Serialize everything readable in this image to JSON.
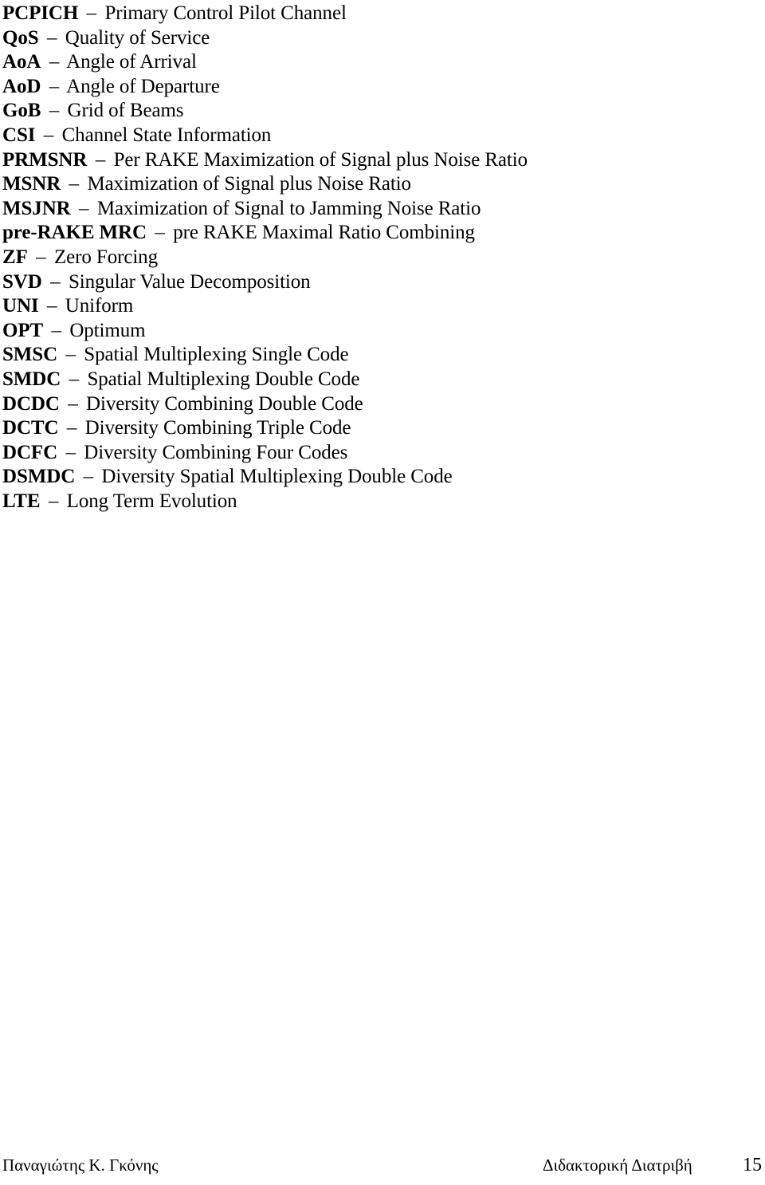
{
  "document": {
    "page_number": "15",
    "separator": "–"
  },
  "abbreviations": [
    {
      "term": "PCPICH",
      "definition": "Primary Control Pilot Channel"
    },
    {
      "term": "QoS",
      "definition": "Quality of Service"
    },
    {
      "term": "AoA",
      "definition": "Angle of Arrival"
    },
    {
      "term": "AoD",
      "definition": "Angle of Departure"
    },
    {
      "term": "GoB",
      "definition": "Grid of Beams"
    },
    {
      "term": "CSI",
      "definition": "Channel State Information"
    },
    {
      "term": "PRMSNR",
      "definition": "Per RAKE Maximization of Signal plus Noise Ratio"
    },
    {
      "term": "MSNR",
      "definition": "Maximization of Signal plus Noise Ratio"
    },
    {
      "term": "MSJNR",
      "definition": "Maximization of Signal to Jamming Noise Ratio"
    },
    {
      "term": "pre-RAKE MRC",
      "definition": "pre RAKE Maximal Ratio Combining"
    },
    {
      "term": "ZF",
      "definition": "Zero Forcing"
    },
    {
      "term": "SVD",
      "definition": "Singular Value Decomposition"
    },
    {
      "term": "UNI",
      "definition": "Uniform"
    },
    {
      "term": "OPT",
      "definition": "Optimum"
    },
    {
      "term": "SMSC",
      "definition": "Spatial Multiplexing Single Code"
    },
    {
      "term": "SMDC",
      "definition": "Spatial Multiplexing Double Code"
    },
    {
      "term": "DCDC",
      "definition": "Diversity Combining Double Code"
    },
    {
      "term": "DCTC",
      "definition": "Diversity Combining Triple Code"
    },
    {
      "term": "DCFC",
      "definition": "Diversity Combining Four Codes"
    },
    {
      "term": "DSMDC",
      "definition": "Diversity Spatial Multiplexing Double Code"
    },
    {
      "term": "LTE",
      "definition": "Long Term Evolution"
    }
  ],
  "footer": {
    "author": "Παναγιώτης Κ. Γκόνης",
    "document_type": "Διδακτορική Διατριβή",
    "page_number": "15"
  }
}
